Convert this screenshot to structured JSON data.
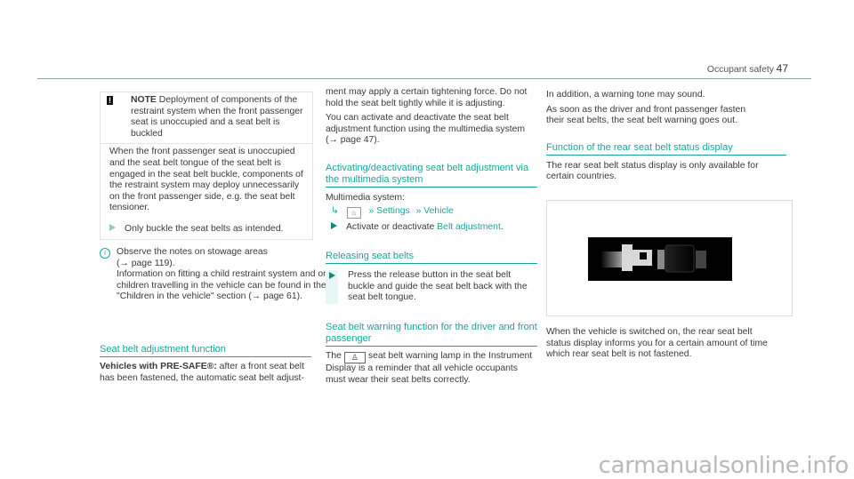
{
  "header": {
    "section_title": "Occupant safety",
    "page_number": "47"
  },
  "note": {
    "label": "NOTE",
    "title": "Deployment of components of the restraint system when the front passenger seat is unoccupied and a seat belt is buckled",
    "body": "When the front passenger seat is unoccupied and the seat belt tongue of the seat belt is engaged in the seat belt buckle, components of the restraint system may deploy unnecessarily on the front passenger side, e.g. the seat belt tensioner.",
    "step": "Only buckle the seat belts as intended."
  },
  "info": {
    "line1": "Observe the notes on stowage areas",
    "line2": "(→ page 119).",
    "line3": "Information on fitting a child restraint system and on children travelling in the vehicle can be found in the \"Children in the vehicle\" section (→ page 61)."
  },
  "seat_belt_adjustment": {
    "heading": "Seat belt adjustment function",
    "lead_bold": "Vehicles with PRE-SAFE®:",
    "lead_text": " after a front seat belt has been fastened, the automatic seat belt adjust-",
    "cont": "ment may apply a certain tightening force. Do not hold the seat belt tightly while it is adjusting.",
    "para2": "You can activate and deactivate the seat belt adjustment function using the multimedia system (→ page 47)."
  },
  "activating": {
    "heading": "Activating/deactivating seat belt adjustment via the multimedia system",
    "intro": "Multimedia system:",
    "path": [
      "Settings",
      "Vehicle"
    ],
    "step_prefix": "Activate or deactivate ",
    "step_link": "Belt adjustment",
    "step_suffix": "."
  },
  "releasing": {
    "heading": "Releasing seat belts",
    "step": "Press the release button in the seat belt buckle and guide the seat belt back with the seat belt tongue."
  },
  "warning_function": {
    "heading": "Seat belt warning function for the driver and front passenger",
    "text_prefix": "The",
    "text_suffix": "seat belt warning lamp in the Instrument Display is a reminder that all vehicle occupants must wear their seat belts correctly.",
    "para2": "In addition, a warning tone may sound.",
    "para3": "As soon as the driver and front passenger fasten their seat belts, the seat belt warning goes out."
  },
  "rear_status": {
    "heading": "Function of the rear seat belt status display",
    "intro": "The rear seat belt status display is only available for certain countries.",
    "after_image": "When the vehicle is switched on, the rear seat belt status display informs you for a certain amount of time which rear seat belt is not fastened."
  },
  "watermark": "carmanualsonline.info"
}
